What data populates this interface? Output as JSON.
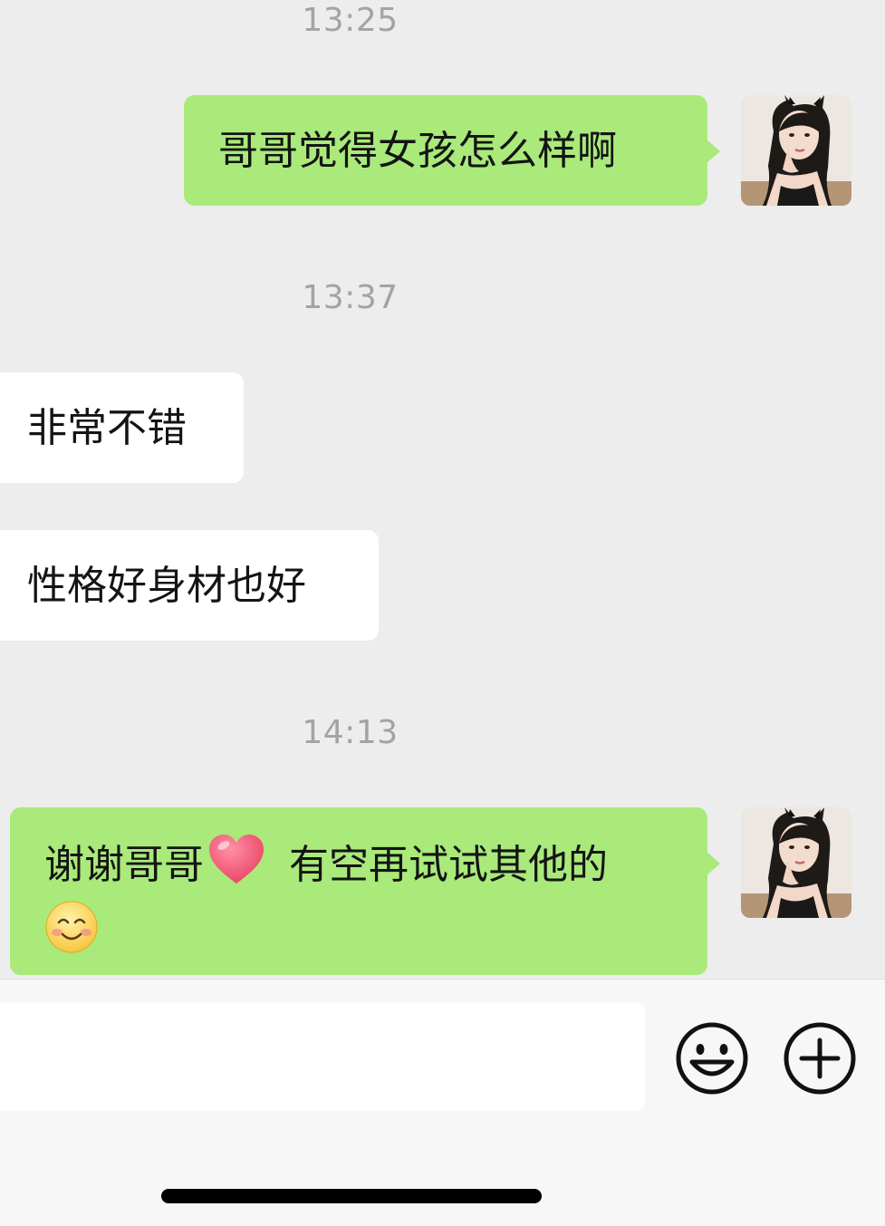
{
  "chat": {
    "messages": [
      {
        "type": "timestamp",
        "text": "13:25"
      },
      {
        "type": "outgoing",
        "text": "哥哥觉得女孩怎么样啊"
      },
      {
        "type": "timestamp",
        "text": "13:37"
      },
      {
        "type": "incoming",
        "text": "非常不错"
      },
      {
        "type": "incoming",
        "text": "性格好身材也好"
      },
      {
        "type": "timestamp",
        "text": "14:13"
      },
      {
        "type": "outgoing",
        "text_part1": "谢谢哥哥",
        "text_part2": "有空再试试其他的",
        "emojis": [
          "heart-emoji",
          "smiling-face-emoji"
        ]
      }
    ]
  },
  "input": {
    "placeholder": "",
    "value": ""
  },
  "icons": {
    "emoji_button": "smiley-face-icon",
    "more_button": "plus-circle-icon"
  },
  "colors": {
    "background": "#ededed",
    "outgoing_bubble": "#a9ea7a",
    "incoming_bubble": "#ffffff",
    "timestamp": "#a3a3a3",
    "input_bar": "#f7f7f7"
  }
}
